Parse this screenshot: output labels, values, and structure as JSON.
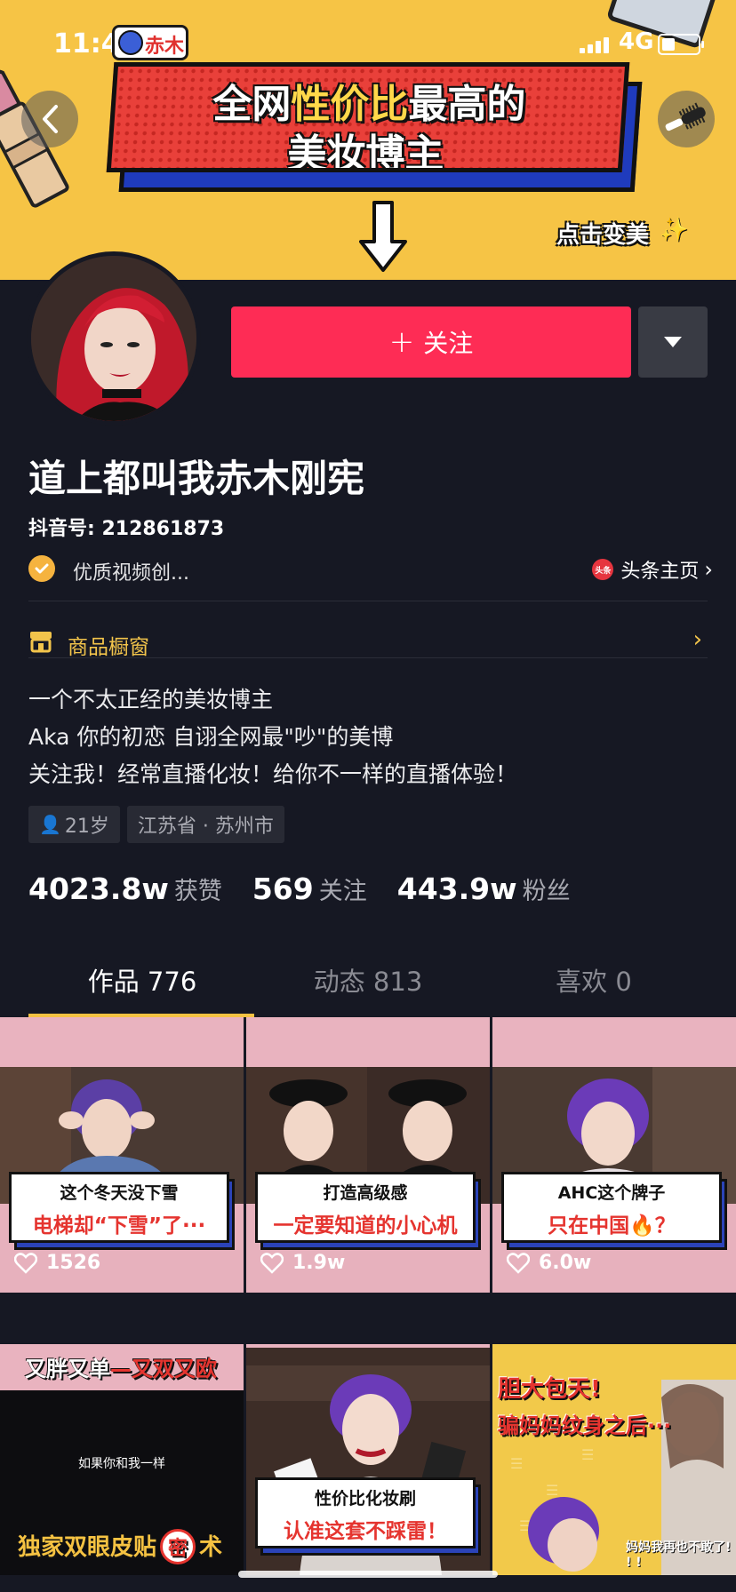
{
  "status_bar": {
    "time": "11:4",
    "app_logo": "赤木",
    "network": "4G"
  },
  "banner": {
    "hero_line1_pre": "全网",
    "hero_line1_highlight": "性价比",
    "hero_line1_post": "最高的",
    "hero_line2": "美妆博主",
    "cta": "点击变美",
    "cta_star": "✨"
  },
  "nav": {
    "back_icon": "chevron-left-icon",
    "more_icon": "mascara-icon"
  },
  "profile": {
    "follow_label": "关注",
    "name": "道上都叫我赤木刚宪",
    "douyin_id": "抖音号: 212861873",
    "verify_text": "优质视频创...",
    "toutiao_badge": "头条",
    "toutiao_label": "头条主页",
    "shop_label": "商品橱窗",
    "bio": [
      "一个不太正经的美妆博主",
      "Aka 你的初恋 自诩全网最\"吵\"的美博",
      "关注我！经常直播化妆！给你不一样的直播体验！"
    ],
    "tags": {
      "age": "21岁",
      "location": "江苏省 · 苏州市"
    },
    "stats": [
      {
        "num": "4023.8w",
        "label": "获赞"
      },
      {
        "num": "569",
        "label": "关注"
      },
      {
        "num": "443.9w",
        "label": "粉丝"
      }
    ]
  },
  "tabs": [
    "作品 776",
    "动态 813",
    "喜欢 0"
  ],
  "videos": [
    {
      "caption_l1": "这个冬天没下雪",
      "caption_l2": "电梯却“下雪”了···",
      "likes": "1526"
    },
    {
      "caption_l1": "打造高级感",
      "caption_l2": "一定要知道的小心机",
      "likes": "1.9w"
    },
    {
      "caption_l1": "AHC这个牌子",
      "caption_l2": "只在中国🔥？",
      "likes": "6.0w"
    },
    {
      "top_pre": "又胖又单",
      "top_red": "—又双又欧",
      "mid": "如果你和我一样",
      "bottom_pre": "独家双眼皮贴",
      "bottom_circle": "密",
      "bottom_post": "术"
    },
    {
      "caption_l1": "性价比化妆刷",
      "caption_l2": "认准这套不踩雷！"
    },
    {
      "line1": "胆大包天!",
      "line2": "骗妈妈纹身之后···",
      "line3": "妈妈我再也不敢了! ! !"
    }
  ],
  "colors": {
    "accent_red": "#fe2c55",
    "gold": "#f5c242",
    "bg": "#161823",
    "banner": "#f6c445"
  }
}
